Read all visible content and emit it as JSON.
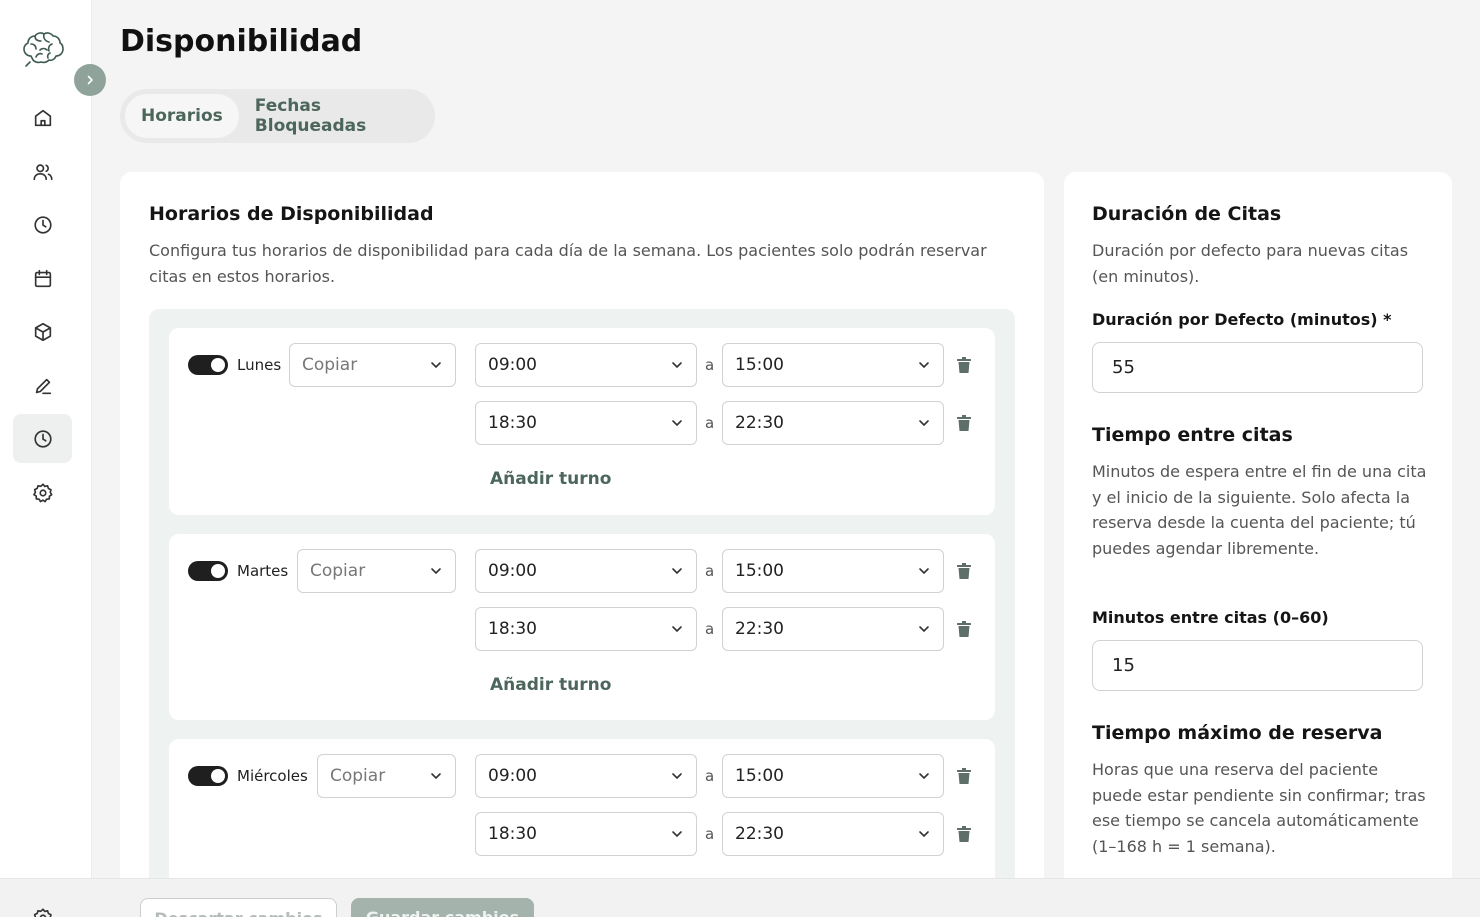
{
  "sidebar": {
    "items": [
      {
        "icon": "home-icon",
        "active": false
      },
      {
        "icon": "users-icon",
        "active": false
      },
      {
        "icon": "clock-icon",
        "active": false
      },
      {
        "icon": "calendar-icon",
        "active": false
      },
      {
        "icon": "box-icon",
        "active": false
      },
      {
        "icon": "pencil-icon",
        "active": false
      },
      {
        "icon": "clock-icon",
        "active": true
      },
      {
        "icon": "gear-icon",
        "active": false
      }
    ]
  },
  "header": {
    "title": "Disponibilidad",
    "tabs": [
      {
        "label": "Horarios",
        "active": true
      },
      {
        "label": "Fechas Bloqueadas",
        "active": false
      }
    ]
  },
  "availability": {
    "title": "Horarios de Disponibilidad",
    "description": "Configura tus horarios de disponibilidad para cada día de la semana. Los pacientes solo podrán reservar citas en estos horarios.",
    "separator": "a",
    "add_shift_label": "Añadir turno",
    "days": [
      {
        "name": "Lunes",
        "enabled": true,
        "copy_label": "Copiar",
        "shifts": [
          {
            "start": "09:00",
            "end": "15:00"
          },
          {
            "start": "18:30",
            "end": "22:30"
          }
        ]
      },
      {
        "name": "Martes",
        "enabled": true,
        "copy_label": "Copiar",
        "shifts": [
          {
            "start": "09:00",
            "end": "15:00"
          },
          {
            "start": "18:30",
            "end": "22:30"
          }
        ]
      },
      {
        "name": "Miércoles",
        "enabled": true,
        "copy_label": "Copiar",
        "shifts": [
          {
            "start": "09:00",
            "end": "15:00"
          },
          {
            "start": "18:30",
            "end": "22:30"
          }
        ]
      }
    ]
  },
  "settings": {
    "duration": {
      "title": "Duración de Citas",
      "description": "Duración por defecto para nuevas citas (en minutos).",
      "field_label": "Duración por Defecto (minutos) *",
      "value": "55"
    },
    "buffer": {
      "title": "Tiempo entre citas",
      "description": "Minutos de espera entre el fin de una cita y el inicio de la siguiente. Solo afecta la reserva desde la cuenta del paciente; tú puedes agendar libremente.",
      "field_label": "Minutos entre citas (0–60)",
      "value": "15"
    },
    "max_booking": {
      "title": "Tiempo máximo de reserva",
      "description": "Horas que una reserva del paciente puede estar pendiente sin confirmar; tras ese tiempo se cancela automáticamente (1–168 h = 1 semana)."
    }
  },
  "footer": {
    "discard_label": "Descartar cambios",
    "save_label": "Guardar cambios"
  },
  "colors": {
    "accent": "#4d665c",
    "toggle_on": "#1f1f1f",
    "background": "#f4f4f4"
  }
}
